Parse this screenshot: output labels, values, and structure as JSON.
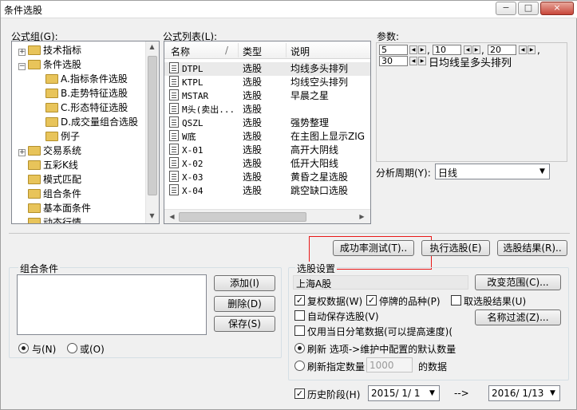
{
  "window": {
    "title": "条件选股",
    "caption_buttons": [
      "−",
      "□",
      "×"
    ]
  },
  "formula_group": {
    "label": "公式组(G):",
    "items": [
      {
        "label": "技术指标",
        "expander": "+"
      },
      {
        "label": "条件选股",
        "expander": "−"
      },
      {
        "label": "A.指标条件选股"
      },
      {
        "label": "B.走势特征选股"
      },
      {
        "label": "C.形态特征选股"
      },
      {
        "label": "D.成交量组合选股"
      },
      {
        "label": "例子"
      },
      {
        "label": "交易系统",
        "expander": "+"
      },
      {
        "label": "五彩K线"
      },
      {
        "label": "模式匹配"
      },
      {
        "label": "组合条件"
      },
      {
        "label": "基本面条件"
      },
      {
        "label": "动态行情"
      }
    ]
  },
  "formula_list": {
    "label": "公式列表(L):",
    "columns": [
      "名称",
      "/",
      "类型",
      "说明"
    ],
    "rows": [
      {
        "name": "DTPL",
        "type": "选股",
        "desc": "均线多头排列"
      },
      {
        "name": "KTPL",
        "type": "选股",
        "desc": "均线空头排列"
      },
      {
        "name": "MSTAR",
        "type": "选股",
        "desc": "早晨之星"
      },
      {
        "name": "M头(卖出...",
        "type": "选股",
        "desc": ""
      },
      {
        "name": "QSZL",
        "type": "选股",
        "desc": "强势整理"
      },
      {
        "name": "W底",
        "type": "选股",
        "desc": "在主图上显示ZIG"
      },
      {
        "name": "X-01",
        "type": "选股",
        "desc": "高开大阴线"
      },
      {
        "name": "X-02",
        "type": "选股",
        "desc": "低开大阳线"
      },
      {
        "name": "X-03",
        "type": "选股",
        "desc": "黄昏之星选股"
      },
      {
        "name": "X-04",
        "type": "选股",
        "desc": "跳空缺口选股"
      }
    ]
  },
  "params": {
    "label": "参数:",
    "values": [
      "5",
      "10",
      "20",
      "30"
    ],
    "sep": ",",
    "description": "日均线呈多头排列"
  },
  "period": {
    "label": "分析周期(Y):",
    "value": "日线"
  },
  "action_buttons": {
    "success_test": "成功率测试(T)..",
    "run_selection": "执行选股(E)",
    "results": "选股结果(R).."
  },
  "combo_conditions": {
    "label": "组合条件",
    "add": "添加(I)",
    "delete": "删除(D)",
    "save": "保存(S)",
    "and_label": "与(N)",
    "or_label": "或(O)"
  },
  "selection_settings": {
    "label": "选股设置",
    "market": "上海A股",
    "change_range": "改变范围(C)...",
    "name_filter": "名称过滤(Z)...",
    "restore_rights": "复权数据(W)",
    "suspended": "停牌的品种(P)",
    "take_results": "取选股结果(U)",
    "auto_save": "自动保存选股(V)",
    "intraday_only": "仅用当日分笔数据(可以提高速度)(",
    "refresh_option": "刷新 选项->维护中配置的默认数量",
    "refresh_specified": "刷新指定数量",
    "count_value": "1000",
    "count_suffix": "的数据"
  },
  "history": {
    "label": "历史阶段(H)",
    "from": "2015/ 1/ 1",
    "arrow": "-->",
    "to": "2016/ 1/13"
  },
  "colors": {
    "highlight_border": "#e81818",
    "folder": "#e8c45a"
  }
}
